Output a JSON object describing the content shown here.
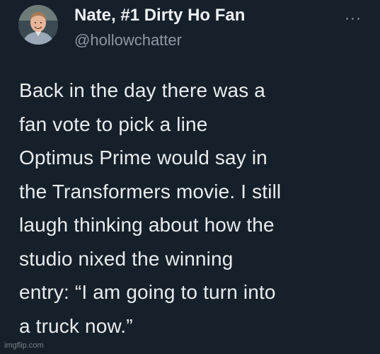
{
  "tweet": {
    "author": {
      "display_name": "Nate, #1 Dirty Ho Fan",
      "handle": "@hollowchatter"
    },
    "more_icon": "more-horizontal-icon",
    "text": "Back in the day there was a\nfan vote to pick a line\nOptimus Prime would say in\nthe Transformers movie. I still\nlaugh thinking about how the\nstudio nixed the winning\nentry: “I am going to turn into\na truck now.”"
  },
  "watermark": "imgflip.com",
  "colors": {
    "background": "#15202b",
    "text_primary": "#e7e9ea",
    "text_secondary": "#8b98a5"
  }
}
